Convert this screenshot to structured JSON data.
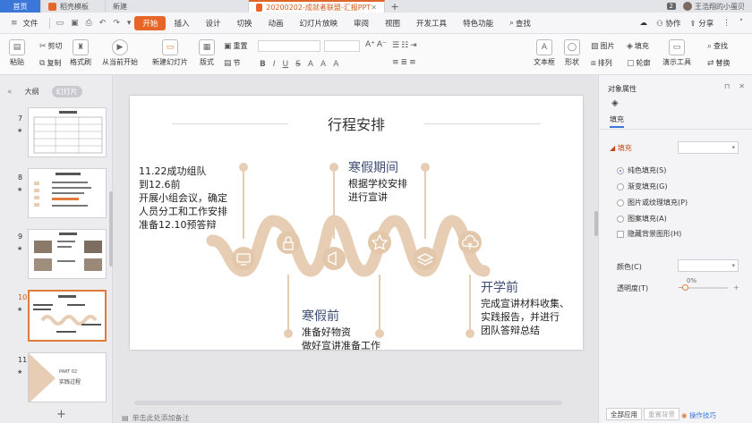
{
  "tabs": {
    "home": "首页",
    "template": "稻壳模板",
    "newtab": "新建",
    "doc": "20200202-成就者联盟-汇报PPT",
    "close": "✕",
    "plus": "+",
    "badge": "2",
    "user": "王浩翔的小蛋贝"
  },
  "menu": {
    "file": "文件",
    "items": [
      "开始",
      "插入",
      "设计",
      "切换",
      "动画",
      "幻灯片放映",
      "审阅",
      "视图",
      "开发工具",
      "特色功能"
    ],
    "search": "查找",
    "coop": "协作",
    "share": "分享"
  },
  "ribbon": {
    "paste": "粘贴",
    "cut": "剪切",
    "copy": "复制",
    "format_painter": "格式刷",
    "from_current": "从当前开始",
    "new_slide": "新建幻灯片",
    "layout": "版式",
    "section": "节",
    "reset": "重置",
    "textbox": "文本框",
    "shape": "形状",
    "arrange": "排列",
    "outline": "轮廓",
    "image": "图片",
    "fill": "填充",
    "find": "查找",
    "replace": "替换",
    "presenter_tools": "演示工具",
    "format_buttons": [
      "B",
      "I",
      "U",
      "S",
      "A",
      "A",
      "A"
    ]
  },
  "leftpanel": {
    "outline": "大纲",
    "slides": "幻灯片",
    "thumbs": [
      {
        "num": "7"
      },
      {
        "num": "8"
      },
      {
        "num": "9"
      },
      {
        "num": "10"
      },
      {
        "num": "11"
      }
    ],
    "thumb11_text": "PART 02",
    "thumb11_sub": "实践过程",
    "add": "+"
  },
  "slide": {
    "title": "行程安排",
    "block1": [
      "11.22成功组队",
      "到12.6前",
      "开展小组会议，确定",
      "人员分工和工作安排",
      "准备12.10预答辩"
    ],
    "winter_period": {
      "heading": "寒假期间",
      "lines": [
        "根据学校安排",
        "进行宣讲"
      ]
    },
    "before_winter": {
      "heading": "寒假前",
      "lines": [
        "准备好物资",
        "做好宣讲准备工作"
      ]
    },
    "before_term": {
      "heading": "开学前",
      "lines": [
        "完成宣讲材料收集、",
        "实践报告，并进行",
        "团队答辩总结"
      ]
    }
  },
  "notes": "单击此处添加备注",
  "rightpanel": {
    "title": "对象属性",
    "tab": "填充",
    "section": "填充",
    "options": [
      "纯色填充(S)",
      "渐变填充(G)",
      "图片或纹理填充(P)",
      "图案填充(A)"
    ],
    "hide_bg": "隐藏背景图形(H)",
    "color_label": "颜色(C)",
    "transparency_label": "透明度(T)",
    "transparency_value": "0%",
    "transparency_fraction": 0,
    "apply_all": "全部应用",
    "reset_bg": "重置背景",
    "tips": "操作技巧"
  },
  "colors": {
    "accent": "#e8652a",
    "wave": "#e6cdb3",
    "heading": "#3e4d73"
  }
}
